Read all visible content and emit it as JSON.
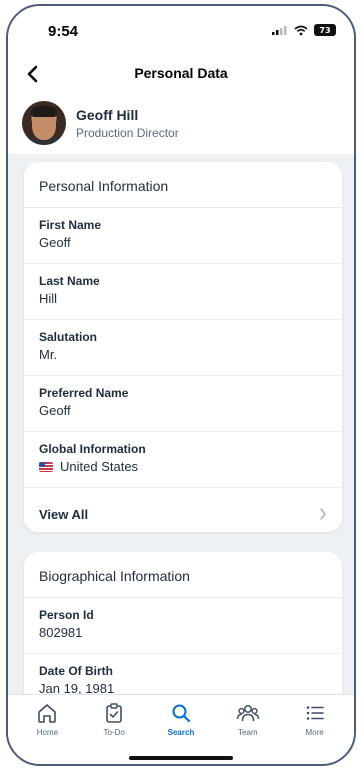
{
  "status": {
    "time": "9:54",
    "battery": "73"
  },
  "nav": {
    "title": "Personal Data"
  },
  "profile": {
    "name": "Geoff Hill",
    "role": "Production Director"
  },
  "personal": {
    "header": "Personal Information",
    "fields": [
      {
        "label": "First Name",
        "value": "Geoff"
      },
      {
        "label": "Last Name",
        "value": "Hill"
      },
      {
        "label": "Salutation",
        "value": "Mr."
      },
      {
        "label": "Preferred Name",
        "value": "Geoff"
      },
      {
        "label": "Global Information",
        "value": "United States",
        "icon": "us-flag-icon"
      }
    ],
    "view_all": "View All"
  },
  "bio": {
    "header": "Biographical Information",
    "fields": [
      {
        "label": "Person Id",
        "value": "802981"
      },
      {
        "label": "Date Of Birth",
        "value": "Jan 19, 1981"
      }
    ]
  },
  "tabs": [
    {
      "label": "Home",
      "icon": "home-icon"
    },
    {
      "label": "To-Do",
      "icon": "clipboard-check-icon"
    },
    {
      "label": "Search",
      "icon": "search-icon",
      "active": true
    },
    {
      "label": "Team",
      "icon": "team-icon"
    },
    {
      "label": "More",
      "icon": "list-icon"
    }
  ],
  "colors": {
    "accent": "#0a6ed1",
    "text": "#1d2d3e",
    "background": "#eef1f4"
  }
}
